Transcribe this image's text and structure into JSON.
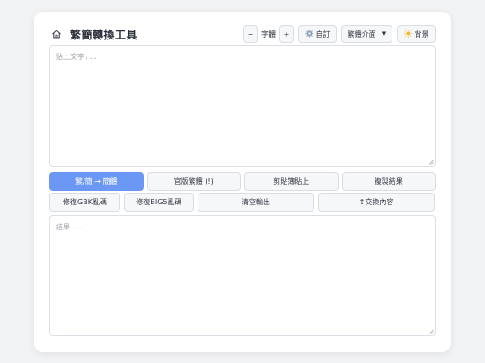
{
  "header": {
    "title": "繁簡轉換工具",
    "home_icon": "home-icon"
  },
  "toolbar": {
    "font_decrease": "−",
    "font_label": "字體",
    "font_increase": "+",
    "custom_label": "自訂",
    "custom_icon": "gear-icon",
    "ui_label": "繁體介面",
    "ui_caret": "▼",
    "bg_label": "背景",
    "bg_icon": "sun-icon"
  },
  "input": {
    "placeholder": "貼上文字..."
  },
  "actions_row1": {
    "convert": "繁/簡 → 簡體",
    "official": "官版繁體 (!)",
    "paste": "剪貼簿貼上",
    "copy": "複製結果"
  },
  "actions_row2": {
    "fix_gbk": "修復GBK亂碼",
    "fix_big5": "修復BIG5亂碼",
    "clear": "清空輸出",
    "swap": "↕交換內容"
  },
  "output": {
    "placeholder": "結果..."
  },
  "colors": {
    "primary": "#6b97f5",
    "background": "#f2f3f5",
    "card": "#ffffff"
  }
}
